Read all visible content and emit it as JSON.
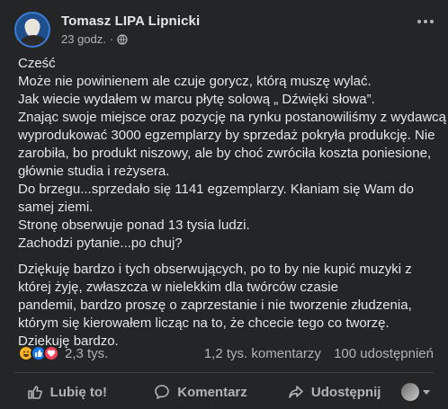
{
  "post": {
    "author": "Tomasz LIPA Lipnicki",
    "time": "23 godz.",
    "separator": "·",
    "paragraphs": [
      [
        "Cześć",
        "Może nie powinienem ale czuje gorycz, którą muszę wylać.",
        "Jak wiecie wydałem w marcu płytę solową „ Dźwięki słowa”.",
        "Znając swoje miejsce oraz pozycję na rynku postanowiliśmy z wydawcą",
        "wyprodukować 3000 egzemplarzy by sprzedaż pokryła produkcję. Nie",
        "zarobiła, bo produkt niszowy, ale by choć zwróciła koszta poniesione,",
        "głównie studia i reżysera.",
        "Do brzegu...sprzedało się 1141 egzemplarzy. Kłaniam się Wam do",
        "samej ziemi.",
        "Stronę obserwuje ponad 13 tysia ludzi.",
        "Zachodzi pytanie...po chuj?"
      ],
      [
        "Dziękuję bardzo i tych obserwujących, po to by nie kupić muzyki z",
        "której żyję, zwłaszcza w nielekkim dla twórców czasie",
        "pandemii, bardzo proszę o zaprzestanie i nie tworzenie złudzenia,",
        "którym się kierowałem licząc na to, że chcecie tego co tworzę.",
        "Dziękuję bardzo."
      ]
    ]
  },
  "stats": {
    "reactions_count": "2,3 tys.",
    "comments": "1,2 tys. komentarzy",
    "shares": "100 udostępnień"
  },
  "actions": {
    "like": "Lubię to!",
    "comment": "Komentarz",
    "share": "Udostępnij"
  },
  "icons": {
    "more": "more-horizontal-icon",
    "privacy": "globe-icon",
    "reactions": [
      "haha-reaction-icon",
      "like-reaction-icon",
      "love-reaction-icon"
    ]
  },
  "colors": {
    "background": "#242526",
    "text": "#e4e6eb",
    "secondary": "#b0b3b8",
    "like_blue": "#1877f2"
  }
}
